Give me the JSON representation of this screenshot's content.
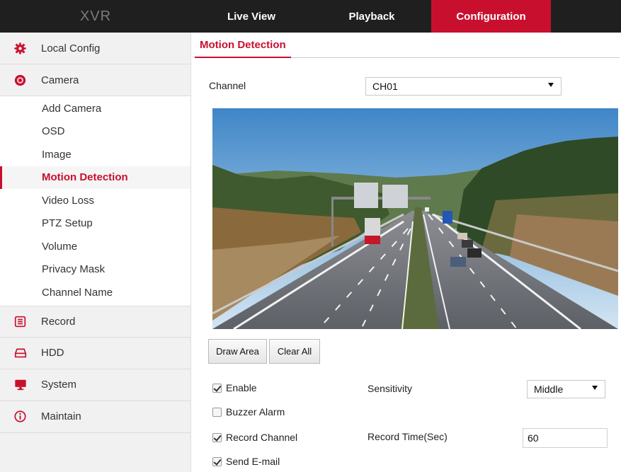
{
  "app": {
    "brand": "XVR",
    "nav": {
      "live_view": "Live View",
      "playback": "Playback",
      "configuration": "Configuration"
    }
  },
  "sidebar": {
    "local_config": "Local Config",
    "camera": "Camera",
    "camera_items": [
      "Add Camera",
      "OSD",
      "Image",
      "Motion Detection",
      "Video Loss",
      "PTZ Setup",
      "Volume",
      "Privacy Mask",
      "Channel Name"
    ],
    "record": "Record",
    "hdd": "HDD",
    "system": "System",
    "maintain": "Maintain"
  },
  "main": {
    "tab": "Motion Detection",
    "channel_label": "Channel",
    "channel_value": "CH01",
    "draw_area": "Draw Area",
    "clear_all": "Clear All",
    "enable_label": "Enable",
    "enable_checked": true,
    "buzzer_label": "Buzzer Alarm",
    "buzzer_checked": false,
    "record_channel_label": "Record Channel",
    "record_channel_checked": true,
    "send_email_label": "Send E-mail",
    "send_email_checked": true,
    "sensitivity_label": "Sensitivity",
    "sensitivity_value": "Middle",
    "record_time_label": "Record Time(Sec)",
    "record_time_value": "60"
  },
  "colors": {
    "accent": "#c8102e",
    "topbar": "#1f1f1f",
    "sidebar_bg": "#f1f1f1"
  }
}
